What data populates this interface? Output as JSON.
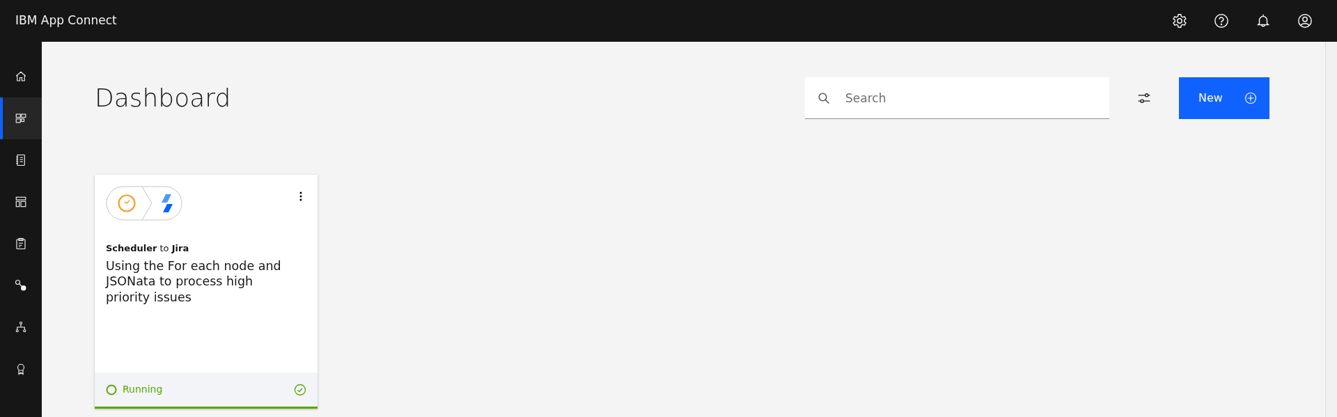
{
  "header": {
    "title": "IBM App Connect"
  },
  "sidebar": {
    "items": [
      {
        "selected": false
      },
      {
        "selected": true
      },
      {
        "selected": false
      },
      {
        "selected": false
      },
      {
        "selected": false
      },
      {
        "selected": false
      },
      {
        "selected": false
      },
      {
        "selected": false
      }
    ]
  },
  "page": {
    "title": "Dashboard"
  },
  "search": {
    "placeholder": "Search"
  },
  "new_button": {
    "label": "New"
  },
  "cards": [
    {
      "subtitle": "**Scheduler** to **Jira**",
      "title": "Using the For each node and JSONata to process high priority issues",
      "status": {
        "kind": "running",
        "label": "Running"
      }
    }
  ]
}
